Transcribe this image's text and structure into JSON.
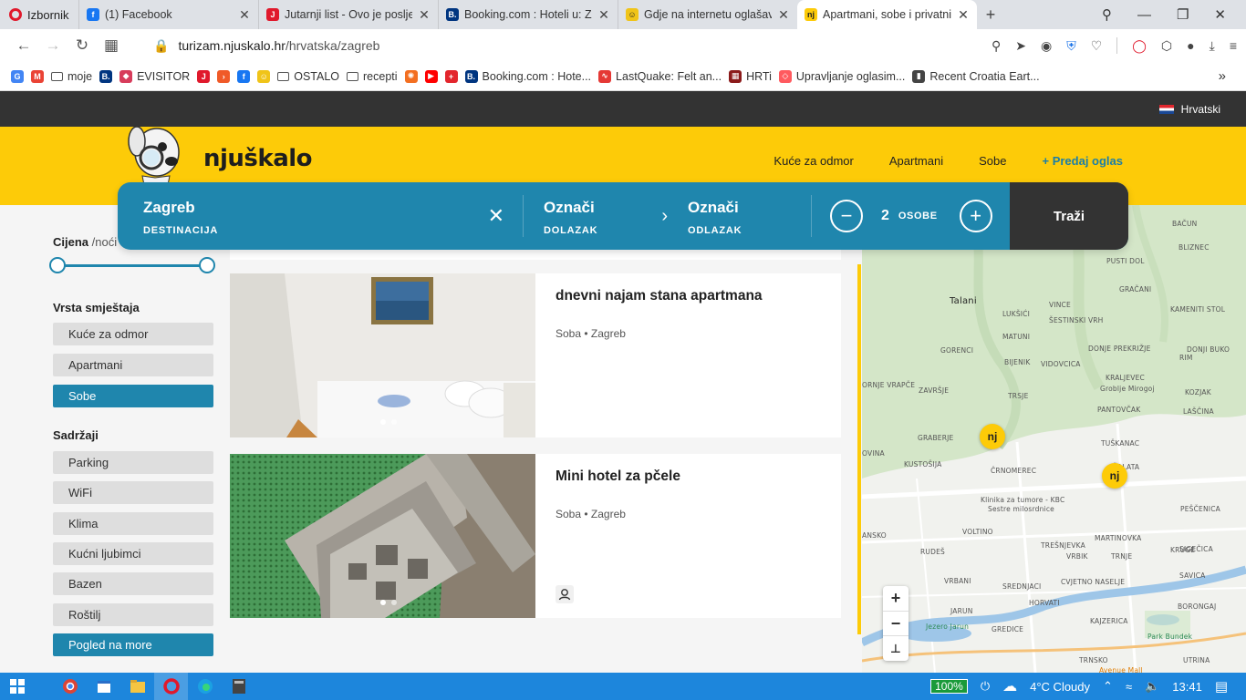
{
  "browser": {
    "menu_label": "Izbornik",
    "tabs": [
      {
        "title": "(1) Facebook",
        "color": "#1877f2",
        "glyph": "f"
      },
      {
        "title": "Jutarnji list - Ovo je posljed",
        "color": "#e0192c",
        "glyph": "J"
      },
      {
        "title": "Booking.com : Hoteli u: Zag",
        "color": "#003580",
        "glyph": "B."
      },
      {
        "title": "Gdje na internetu oglašavat",
        "color": "#f0c419",
        "glyph": "☺"
      },
      {
        "title": "Apartmani, sobe i privatni s",
        "color": "#fdcb08",
        "glyph": "nj"
      }
    ],
    "url_host": "turizam.njuskalo.hr",
    "url_path": "/hrvatska/zagreb",
    "bookmarks": [
      {
        "label": "",
        "icon": "google-icon",
        "color": "#4285f4",
        "glyph": "G"
      },
      {
        "label": "",
        "icon": "gmail-icon",
        "color": "#ea4335",
        "glyph": "M"
      },
      {
        "label": "moje",
        "icon": "folder-icon"
      },
      {
        "label": "",
        "icon": "booking-icon",
        "color": "#003580",
        "glyph": "B."
      },
      {
        "label": "EVISITOR",
        "icon": "evisitor-icon",
        "color": "#d73c5b",
        "glyph": "◆"
      },
      {
        "label": "",
        "icon": "jutarnji-icon",
        "color": "#e0192c",
        "glyph": "J"
      },
      {
        "label": "",
        "icon": "arrow-app-icon",
        "color": "#f05a28",
        "glyph": "›"
      },
      {
        "label": "",
        "icon": "facebook-icon",
        "color": "#1877f2",
        "glyph": "f"
      },
      {
        "label": "",
        "icon": "sun-icon",
        "color": "#f0c419",
        "glyph": "☺"
      },
      {
        "label": "OSTALO",
        "icon": "folder-icon"
      },
      {
        "label": "recepti",
        "icon": "folder-icon"
      },
      {
        "label": "",
        "icon": "weather-icon",
        "color": "#f36f21",
        "glyph": "✺"
      },
      {
        "label": "",
        "icon": "youtube-icon",
        "color": "#ff0000",
        "glyph": "▶"
      },
      {
        "label": "",
        "icon": "swiss-cross-icon",
        "color": "#e3262d",
        "glyph": "+"
      },
      {
        "label": "Booking.com : Hote...",
        "icon": "booking-icon",
        "color": "#003580",
        "glyph": "B."
      },
      {
        "label": "LastQuake: Felt an...",
        "icon": "lastquake-icon",
        "color": "#e53935",
        "glyph": "∿"
      },
      {
        "label": "HRTi",
        "icon": "hrti-icon",
        "color": "#8b1a1a",
        "glyph": "▦"
      },
      {
        "label": "Upravljanje oglasim...",
        "icon": "airbnb-icon",
        "color": "#ff5a5f",
        "glyph": "◇"
      },
      {
        "label": "Recent Croatia Eart...",
        "icon": "document-icon",
        "color": "#444",
        "glyph": "▮"
      }
    ]
  },
  "site": {
    "language": "Hrvatski",
    "logo": "njuškalo",
    "nav": [
      "Kuće za odmor",
      "Apartmani",
      "Sobe"
    ],
    "post_ad": "+ Predaj oglas",
    "search": {
      "destination": "Zagreb",
      "destination_label": "DESTINACIJA",
      "checkin": "Označi",
      "checkin_label": "DOLAZAK",
      "checkout": "Označi",
      "checkout_label": "ODLAZAK",
      "persons": "2",
      "persons_label": "OSOBE",
      "search_button": "Traži"
    },
    "filters": {
      "price_label": "Cijena",
      "price_unit": "/noći",
      "price_range": [
        0,
        1
      ],
      "type_title": "Vrsta smještaja",
      "types": [
        {
          "label": "Kuće za odmor",
          "selected": false
        },
        {
          "label": "Apartmani",
          "selected": false
        },
        {
          "label": "Sobe",
          "selected": true
        }
      ],
      "amenities_title": "Sadržaji",
      "amenities": [
        {
          "label": "Parking",
          "selected": false
        },
        {
          "label": "WiFi",
          "selected": false
        },
        {
          "label": "Klima",
          "selected": false
        },
        {
          "label": "Kućni ljubimci",
          "selected": false
        },
        {
          "label": "Bazen",
          "selected": false
        },
        {
          "label": "Roštilj",
          "selected": false
        },
        {
          "label": "Pogled na more",
          "selected": true
        }
      ]
    },
    "results": [
      {
        "title": "dnevni najam stana apartmana",
        "meta": "Soba • Zagreb",
        "image_dots": 2,
        "active_dot": 0
      },
      {
        "title": "Mini hotel za pčele",
        "meta": "Soba • Zagreb",
        "image_dots": 2,
        "active_dot": 0,
        "has_host_icon": true
      }
    ],
    "map": {
      "labels": [
        "BAČUN",
        "BLIZNEC",
        "PUSTI DOL",
        "GRAČANI",
        "Talani",
        "LUKŠIĆI",
        "VINCE",
        "ŠESTINSKI VRH",
        "KAMENITI STOL",
        "MATUNI",
        "GORENCI",
        "DONJE PREKRIŽJE",
        "DONJI BUKO",
        "BIJENIK",
        "VIDOVCICA",
        "RIM",
        "ORNJE VRAPČE",
        "ZAVRŠJE",
        "KRALJEVEC",
        "Groblje Mirogoj",
        "TRSJE",
        "KOZJAK",
        "PANTOVČAK",
        "LAŠČINA",
        "GRABERJE",
        "TUŠKANAC",
        "OVINA",
        "KUSTOŠIJA",
        "ČRNOMEREC",
        "ŠALATA",
        "Klinika za tumore - KBC",
        "Sestre milosrdnice",
        "PEŠČENICA",
        "VOLTINO",
        "MARTINOVKA",
        "ANSKO",
        "TREŠNJEVKA",
        "KRUGE",
        "SIGEČICA",
        "RUDEŠ",
        "VRBIK",
        "TRNJE",
        "CVJETNO NASELJE",
        "SAVICA",
        "VRBANI",
        "SREDNJACI",
        "JARUN",
        "HORVATI",
        "BORONGAJ",
        "Jezero Jarun",
        "KAJZERICA",
        "Park Bundek",
        "GREDICE",
        "TRNSKO",
        "Avenue Mall",
        "UTRINA"
      ],
      "zoom_in": "+",
      "zoom_out": "−",
      "reset": "⊥",
      "pins": [
        "nj",
        "nj"
      ]
    }
  },
  "taskbar": {
    "battery": "100%",
    "weather": "4°C  Cloudy",
    "time": "13:41"
  }
}
